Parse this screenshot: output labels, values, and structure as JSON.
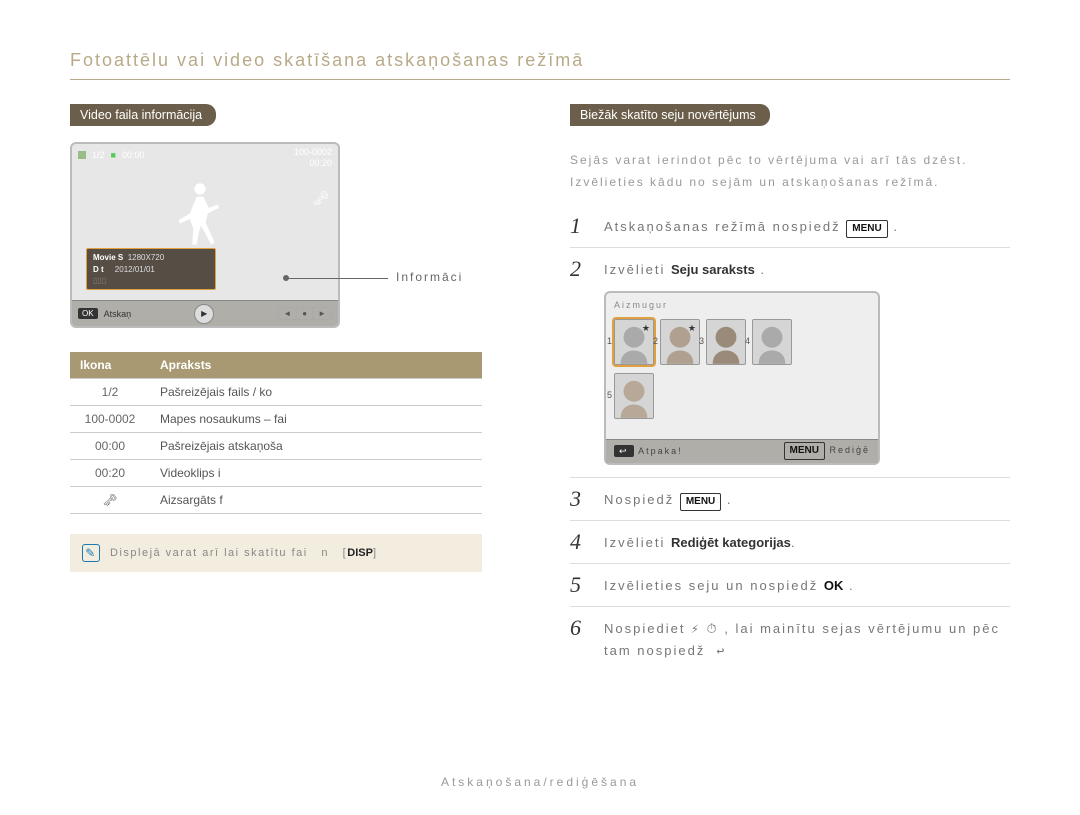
{
  "page": {
    "heading": "Fotoattēlu vai video skatīšana atskaņošanas režīmā",
    "footer": "Atskaņošana/rediģēšana"
  },
  "left": {
    "pill": "Video faila informācija",
    "cam": {
      "page_indicator": "1/2",
      "time_elapsed": "00:00",
      "file_no": "100-0002",
      "time_total": "00:20",
      "info_line1_label": "Movie S",
      "info_line1_val": "1280X720",
      "info_line2_label": "D t",
      "info_line2_val": "2012/01/01",
      "bot_ok": "OK",
      "bot_ok_text": "Atskaņ",
      "seg1": "◄",
      "seg2": "●",
      "seg3": "►"
    },
    "callout": "Informāci",
    "table": {
      "head_icon": "Ikona",
      "head_desc": "Apraksts",
      "rows": [
        {
          "icon": "1/2",
          "desc": "Pašreizējais fails / ko"
        },
        {
          "icon": "100-0002",
          "desc": "Mapes nosaukums – fai"
        },
        {
          "icon": "00:00",
          "desc": "Pašreizējais atskaņoša"
        },
        {
          "icon": "00:20",
          "desc": "Videoklips i"
        },
        {
          "icon": "lock",
          "desc": "Aizsargāts f"
        }
      ]
    },
    "note": "Displejā varat arī lai skatītu fai   n   [DISP]"
  },
  "right": {
    "pill": "Biežāk skatīto seju novērtējums",
    "intro": "Sejās varat ierindot pēc to vērtējuma vai arī tās dzēst. Izvēlieties kādu no sejām un atskaņošanas režīmā.",
    "steps": [
      {
        "n": "1",
        "text": "Atskaņošanas režīmā nospiedž ",
        "suffix_icon": "menu"
      },
      {
        "n": "2",
        "text": "Izvēlieti ",
        "bold": "Seju saraksts",
        "suffix": " ."
      },
      {
        "n": "3",
        "text": "Nospiedž ",
        "suffix_icon": "menu"
      },
      {
        "n": "4",
        "text": "Izvēlieti ",
        "bold": "Rediģēt kategorijas",
        "suffix": "."
      },
      {
        "n": "5",
        "text": "Izvēlieties seju un nospiedž ",
        "ok": "OK",
        "suffix": " ."
      },
      {
        "n": "6",
        "text": "Nospiediet ⚡ ⏱ , lai mainītu sejas vērtējumu un pēc tam nospiedž  ↩"
      }
    ],
    "cam2": {
      "label": "Aizmugur",
      "faces": [
        {
          "n": "1",
          "star": "★"
        },
        {
          "n": "2",
          "star": "★"
        },
        {
          "n": "3",
          "star": ""
        },
        {
          "n": "4",
          "star": ""
        }
      ],
      "faces2": [
        {
          "n": "5",
          "star": ""
        }
      ],
      "bot_back": "↩",
      "bot_back_text": "Atpaka!",
      "bot_menu_text": "Rediģē"
    }
  }
}
